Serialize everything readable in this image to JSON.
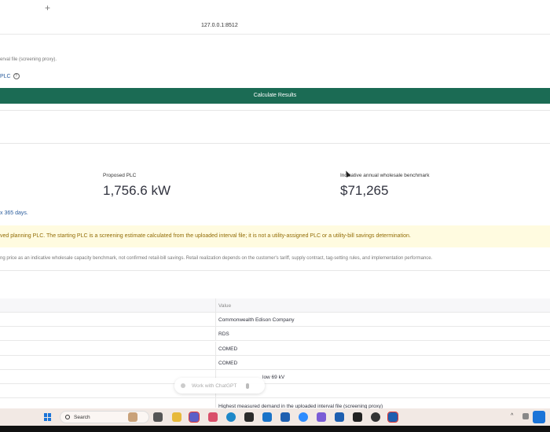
{
  "browser": {
    "new_tab": "+",
    "url": "127.0.0.1:8512"
  },
  "upload": {
    "caption": "erval file (screening proxy).",
    "plc_label": "PLC",
    "help_icon": "question-circle-icon"
  },
  "calculate_button": "Calculate Results",
  "metrics": {
    "proposed_plc_label": "Proposed PLC",
    "proposed_plc_value": "1,756.6 kW",
    "benchmark_label": "Indicative annual wholesale benchmark",
    "benchmark_value": "$71,265"
  },
  "days_text": "x 365 days.",
  "warning_text": "ved planning PLC. The starting PLC is a screening estimate calculated from the uploaded interval file; it is not a utility-assigned PLC or a utility-bill savings determination.",
  "note_text": "ng price as an indicative wholesale capacity benchmark, not confirmed retail-bill savings. Retail realization depends on the customer's tariff, supply contract, tag-setting rules, and implementation performance.",
  "table": {
    "header_value": "Value",
    "rows": [
      "Commonwealth Edison Company",
      "RDS",
      "COMED",
      "COMED",
      "low 69 kV",
      "",
      "Highest measured demand in the uploaded interval file (screening proxy)"
    ]
  },
  "chat_overlay": {
    "placeholder": "Work with ChatGPT"
  },
  "taskbar": {
    "search_label": "Search",
    "accent": "#1b74d8",
    "tray_chevron": "^"
  },
  "colors": {
    "button": "#1b6b54",
    "warning_bg": "#fffbe0",
    "warning_text": "#926c05",
    "link": "#2a5c9c"
  }
}
